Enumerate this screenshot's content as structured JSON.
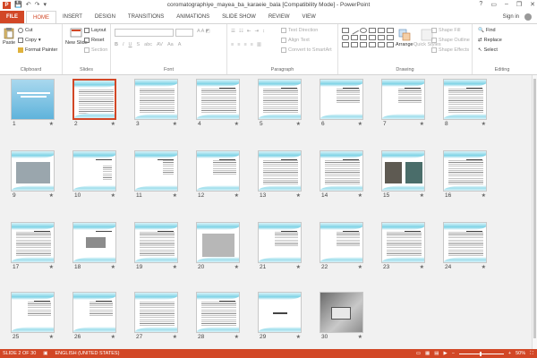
{
  "app": {
    "title": "coromatographiye_mayea_ba_karaeie_bala [Compatibility Mode] - PowerPoint",
    "sign_in": "Sign in",
    "qat": [
      "💾",
      "↶",
      "↷",
      "▾"
    ],
    "win_ctrls": [
      "?",
      "▭",
      "–",
      "❐",
      "✕"
    ]
  },
  "tabs": [
    "FILE",
    "HOME",
    "INSERT",
    "DESIGN",
    "TRANSITIONS",
    "ANIMATIONS",
    "SLIDE SHOW",
    "REVIEW",
    "VIEW"
  ],
  "ribbon": {
    "clipboard": {
      "label": "Clipboard",
      "paste": "Paste",
      "cut": "Cut",
      "copy": "Copy",
      "format_painter": "Format Painter"
    },
    "slides": {
      "label": "Slides",
      "new_slide": "New Slide",
      "layout": "Layout",
      "reset": "Reset",
      "section": "Section"
    },
    "font": {
      "label": "Font"
    },
    "paragraph": {
      "label": "Paragraph",
      "text_direction": "Text Direction",
      "align_text": "Align Text",
      "convert_smartart": "Convert to SmartArt"
    },
    "drawing": {
      "label": "Drawing",
      "arrange": "Arrange",
      "quick_styles": "Quick Styles",
      "shape_fill": "Shape Fill",
      "shape_outline": "Shape Outline",
      "shape_effects": "Shape Effects"
    },
    "editing": {
      "label": "Editing",
      "find": "Find",
      "replace": "Replace",
      "select": "Select"
    }
  },
  "slides": [
    {
      "num": "1",
      "star": "★"
    },
    {
      "num": "2",
      "star": "★"
    },
    {
      "num": "3",
      "star": "★"
    },
    {
      "num": "4",
      "star": "★"
    },
    {
      "num": "5",
      "star": "★"
    },
    {
      "num": "6",
      "star": "★"
    },
    {
      "num": "7",
      "star": "★"
    },
    {
      "num": "8",
      "star": "★"
    },
    {
      "num": "9",
      "star": "★"
    },
    {
      "num": "10",
      "star": "★"
    },
    {
      "num": "11",
      "star": "★"
    },
    {
      "num": "12",
      "star": "★"
    },
    {
      "num": "13",
      "star": "★"
    },
    {
      "num": "14",
      "star": "★"
    },
    {
      "num": "15",
      "star": "★"
    },
    {
      "num": "16",
      "star": "★"
    },
    {
      "num": "17",
      "star": "★"
    },
    {
      "num": "18",
      "star": "★"
    },
    {
      "num": "19",
      "star": "★"
    },
    {
      "num": "20",
      "star": "★"
    },
    {
      "num": "21",
      "star": "★"
    },
    {
      "num": "22",
      "star": "★"
    },
    {
      "num": "23",
      "star": "★"
    },
    {
      "num": "24",
      "star": "★"
    },
    {
      "num": "25",
      "star": "★"
    },
    {
      "num": "26",
      "star": "★"
    },
    {
      "num": "27",
      "star": "★"
    },
    {
      "num": "28",
      "star": "★"
    },
    {
      "num": "29",
      "star": "★"
    },
    {
      "num": "30",
      "star": "★"
    }
  ],
  "status": {
    "slide_info": "SLIDE 2 OF 30",
    "language": "ENGLISH (UNITED STATES)",
    "zoom": "50%",
    "accent": "#d24726"
  }
}
